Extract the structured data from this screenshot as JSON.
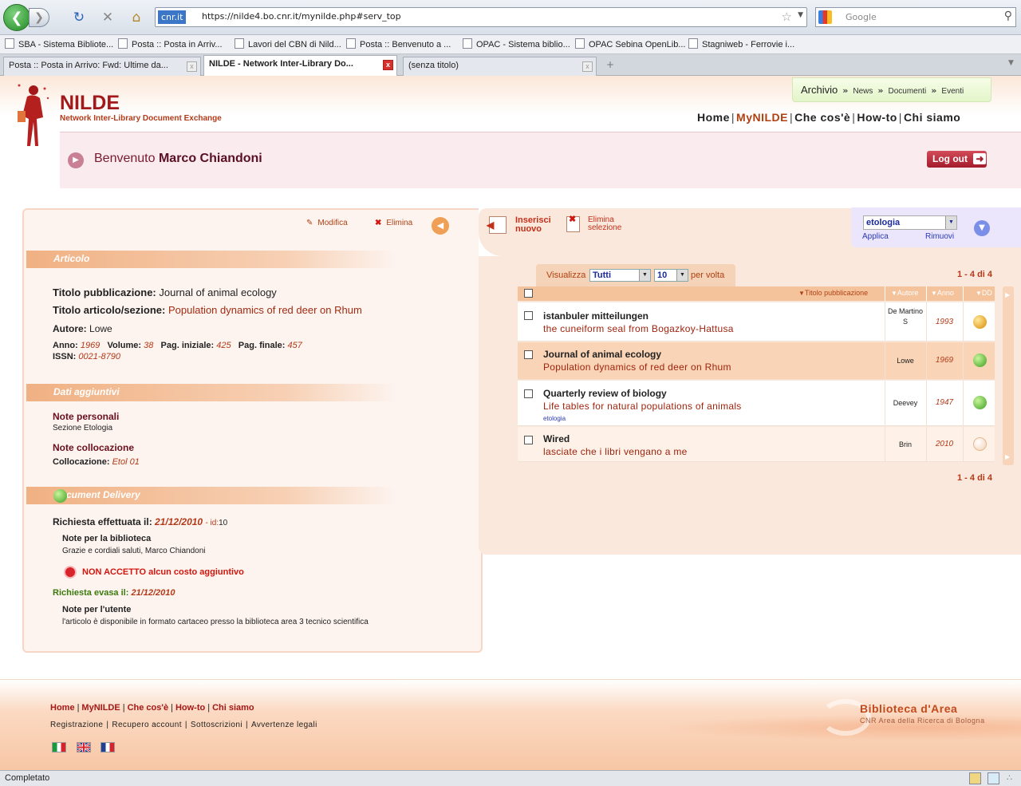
{
  "browser": {
    "url_site": "cnr.it",
    "url": "https://nilde4.bo.cnr.it/mynilde.php#serv_top",
    "search_placeholder": "Google",
    "bookmarks": [
      "SBA - Sistema Bibliote...",
      "Posta :: Posta in Arriv...",
      "Lavori del CBN di Nild...",
      "Posta :: Benvenuto a ...",
      "OPAC - Sistema biblio...",
      "OPAC Sebina OpenLib...",
      "Stagniweb - Ferrovie i..."
    ],
    "tabs": [
      "Posta :: Posta in Arrivo: Fwd: Ultime da...",
      "NILDE - Network Inter-Library Do...",
      "(senza titolo)"
    ],
    "status": "Completato"
  },
  "header": {
    "logo_title": "NILDE",
    "logo_subtitle": "Network Inter-Library Document Exchange",
    "archive": "Archivio",
    "archive_links": [
      "News",
      "Documenti",
      "Eventi"
    ],
    "nav": [
      "Home",
      "MyNILDE",
      "Che cos'è",
      "How-to",
      "Chi siamo"
    ],
    "welcome_prefix": "Benvenuto",
    "user_name": "Marco Chiandoni",
    "logout": "Log out"
  },
  "detail": {
    "edit": "Modifica",
    "delete": "Elimina",
    "section_article": "Articolo",
    "pub_title_label": "Titolo pubblicazione:",
    "pub_title": "Journal of animal ecology",
    "article_title_label": "Titolo articolo/sezione:",
    "article_title": "Population dynamics of red deer on Rhum",
    "author_label": "Autore:",
    "author": "Lowe",
    "year_label": "Anno:",
    "year": "1969",
    "volume_label": "Volume:",
    "volume": "38",
    "page_start_label": "Pag. iniziale:",
    "page_start": "425",
    "page_end_label": "Pag. finale:",
    "page_end": "457",
    "issn_label": "ISSN:",
    "issn": "0021-8790",
    "section_extra": "Dati aggiuntivi",
    "personal_notes_label": "Note personali",
    "personal_notes": "Sezione Etologia",
    "location_notes_label": "Note collocazione",
    "location_label": "Collocazione:",
    "location": "Etol 01",
    "section_dd": "Document Delivery",
    "request_label": "Richiesta effettuata il:",
    "request_date": "21/12/2010",
    "request_id_label": "- id:",
    "request_id": "10",
    "library_notes_label": "Note per la biblioteca",
    "library_notes": "Grazie e cordiali saluti, Marco Chiandoni",
    "no_cost": "NON ACCETTO alcun costo aggiuntivo",
    "fulfilled_label": "Richiesta evasa il:",
    "fulfilled_date": "21/12/2010",
    "user_notes_label": "Note per l'utente",
    "user_notes": "l'articolo è disponibile in formato cartaceo presso la biblioteca area 3 tecnico scientifica"
  },
  "list": {
    "insert_1": "Inserisci",
    "insert_2": "nuovo",
    "delete_1": "Elimina",
    "delete_2": "selezione",
    "filter_value": "etologia",
    "apply": "Applica",
    "remove": "Rimuovi",
    "show_label": "Visualizza",
    "show_value": "Tutti",
    "per_page_value": "10",
    "per_page_label": "per volta",
    "count": "1 - 4 di 4",
    "col_title": "Titolo pubblicazione",
    "col_author": "Autore",
    "col_year": "Anno",
    "col_dd": "DD",
    "rows": [
      {
        "title": "istanbuler mitteilungen",
        "subtitle": "the cuneiform seal from Bogazkoy-Hattusa",
        "tag": "",
        "author": "De Martino S",
        "year": "1993",
        "dd": "pending"
      },
      {
        "title": "Journal of animal ecology",
        "subtitle": "Population dynamics of red deer on Rhum",
        "tag": "",
        "author": "Lowe",
        "year": "1969",
        "dd": "fulfilled"
      },
      {
        "title": "Quarterly review of biology",
        "subtitle": "Life tables for natural populations of animals",
        "tag": "etologia",
        "author": "Deevey",
        "year": "1947",
        "dd": "fulfilled"
      },
      {
        "title": "Wired",
        "subtitle": "lasciate che i libri vengano a me",
        "tag": "",
        "author": "Brin",
        "year": "2010",
        "dd": "none"
      }
    ]
  },
  "footer": {
    "nav": [
      "Home",
      "MyNILDE",
      "Che cos'è",
      "How-to",
      "Chi siamo"
    ],
    "links": [
      "Registrazione",
      "Recupero account",
      "Sottoscrizioni",
      "Avvertenze legali"
    ],
    "brand_title": "Biblioteca d'Area",
    "brand_subtitle": "CNR Area della Ricerca di Bologna"
  },
  "colors": {
    "brand": "#a31919",
    "accent": "#b04012",
    "panel": "#fbe8dc"
  }
}
